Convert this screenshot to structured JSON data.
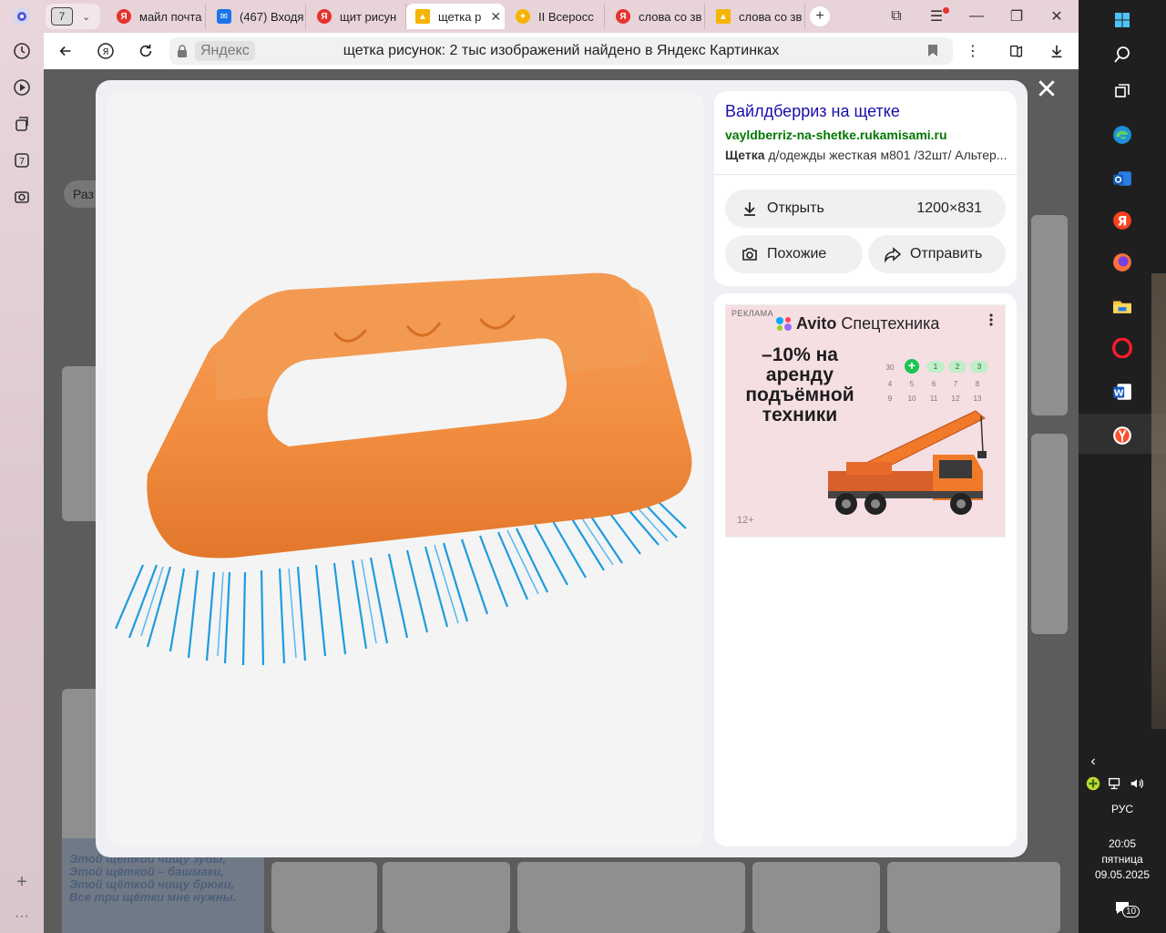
{
  "browser": {
    "tab_count": "7",
    "tabs": [
      {
        "label": "майл почта",
        "icon": "yandex-icon",
        "color": "#e5322d"
      },
      {
        "label": "(467) Входя",
        "icon": "mail-icon",
        "color": "#1a73e8"
      },
      {
        "label": "щит рисун",
        "icon": "yandex-icon",
        "color": "#e5322d"
      },
      {
        "label": "щетка р",
        "icon": "yandex-images-icon",
        "color": "#f5b400",
        "active": true
      },
      {
        "label": "II Всеросс",
        "icon": "yandex-zen-icon",
        "color": "#f5b400"
      },
      {
        "label": "слова со зв",
        "icon": "yandex-icon",
        "color": "#e5322d"
      },
      {
        "label": "слова со зв",
        "icon": "yandex-images-icon",
        "color": "#f5b400"
      }
    ],
    "omnibox": {
      "chip": "Яндекс",
      "title": "щетка рисунок: 2 тыс изображений найдено в Яндекс Картинках"
    }
  },
  "page": {
    "filter_chip": "Раз",
    "poem_lines": [
      "Этой щёткой чищу зубы,",
      "Этой щёткой – башмаки,",
      "Этой щёткой чищу брюки,",
      "Все три щётки мне нужны."
    ]
  },
  "viewer": {
    "source": {
      "title": "Вайлдберриз на щетке",
      "domain": "vayldberriz-na-shetke.rukamisami.ru",
      "desc_bold": "Щетка",
      "desc_rest": " д/одежды жесткая м801 /32шт/ Альтер..."
    },
    "actions": {
      "open": "Открыть",
      "size": "1200×831",
      "similar": "Похожие",
      "share": "Отправить"
    },
    "ad": {
      "label": "РЕКЛАМА",
      "brand": "Avito",
      "brand_suffix": "Спецтехника",
      "headline": "–10% на аренду подъёмной техники",
      "age": "12+",
      "calendar": [
        "30",
        "1",
        "2",
        "3",
        "4",
        "5",
        "6",
        "7",
        "8",
        "9",
        "10",
        "11",
        "12",
        "13"
      ]
    }
  },
  "taskbar": {
    "lang": "РУС",
    "time": "20:05",
    "day": "пятница",
    "date": "09.05.2025",
    "notifications": "10"
  },
  "colors": {
    "accent_link": "#1a0dab",
    "domain_green": "#007700",
    "brush_orange": "#f08a3c",
    "brush_blue": "#1e9be0"
  }
}
